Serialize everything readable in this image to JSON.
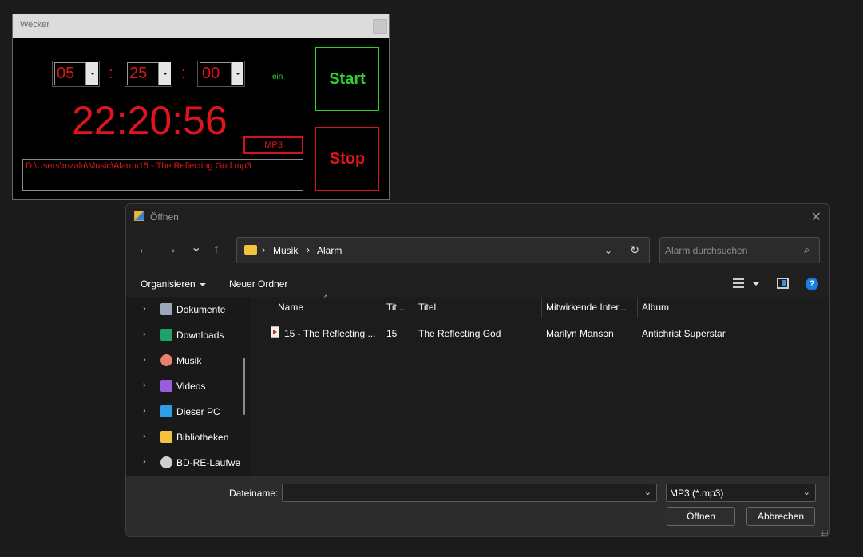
{
  "wecker": {
    "title": "Wecker",
    "hours": "05",
    "minutes": "25",
    "seconds": "00",
    "colon": ":",
    "status": "ein",
    "clock": "22:20:56",
    "mp3_label": "MP3",
    "path": "D:\\Users\\mzala\\Music\\Alarm\\15 - The Reflecting God.mp3",
    "start_label": "Start",
    "stop_label": "Stop"
  },
  "dialog": {
    "title": "Öffnen",
    "close": "✕",
    "nav": {
      "back": "←",
      "forward": "→",
      "recent": "⌄",
      "up": "↑"
    },
    "address": {
      "sep": "›",
      "crumbs": [
        "Musik",
        "Alarm"
      ],
      "dropdown": "⌄",
      "refresh": "↻"
    },
    "search": {
      "placeholder": "Alarm durchsuchen",
      "icon": "⌕"
    },
    "toolbar": {
      "organize": "Organisieren",
      "new_folder": "Neuer Ordner",
      "help": "?"
    },
    "sidebar": {
      "chevron": "›",
      "items": [
        {
          "label": "Dokumente",
          "icon": "document-icon",
          "color": "#9aa7b8"
        },
        {
          "label": "Downloads",
          "icon": "download-icon",
          "color": "#1fa36b"
        },
        {
          "label": "Musik",
          "icon": "music-icon",
          "color": "#e8806a"
        },
        {
          "label": "Videos",
          "icon": "video-icon",
          "color": "#9a5ce0"
        },
        {
          "label": "Dieser PC",
          "icon": "computer-icon",
          "color": "#2f9ee8"
        },
        {
          "label": "Bibliotheken",
          "icon": "folder-icon",
          "color": "#f3c240"
        },
        {
          "label": "BD-RE-Laufwe",
          "icon": "disc-drive-icon",
          "color": "#cfcfcf"
        }
      ]
    },
    "columns": [
      "Name",
      "Tit...",
      "Titel",
      "Mitwirkende Inter...",
      "Album"
    ],
    "sort_indicator": "^",
    "file": {
      "name": "15 - The Reflecting ...",
      "track": "15",
      "title": "The Reflecting God",
      "artist": "Marilyn Manson",
      "album": "Antichrist Superstar"
    },
    "bottom": {
      "filename_label": "Dateiname:",
      "filename_value": "",
      "dropdown": "⌄",
      "filetype": "MP3 (*.mp3)",
      "open_label": "Öffnen",
      "cancel_label": "Abbrechen"
    }
  }
}
